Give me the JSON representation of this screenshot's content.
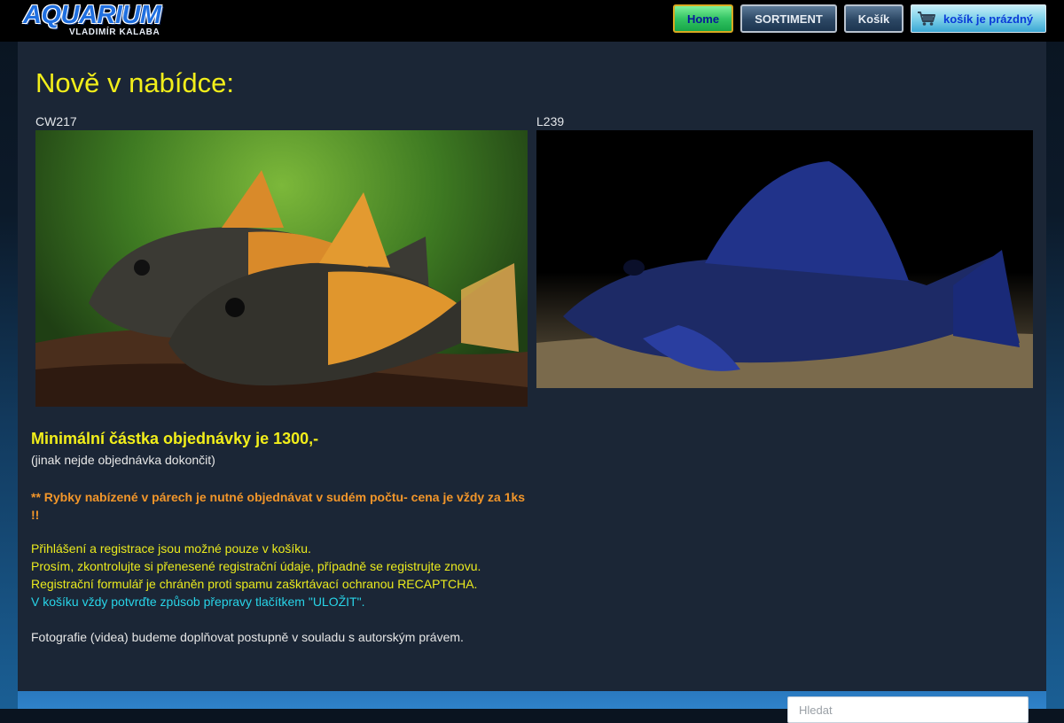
{
  "header": {
    "logo_title": "AQUARIUM",
    "logo_subtitle": "VLADIMÍR KALABA",
    "nav": {
      "home": "Home",
      "sortiment": "SORTIMENT",
      "kosik": "Košík",
      "cart_status": "košík je prázdný"
    }
  },
  "main": {
    "title": "Nově v nabídce:",
    "products": [
      {
        "caption": "CW217",
        "image": "fish-photo-corydoras"
      },
      {
        "caption": "L239",
        "image": "fish-photo-pleco"
      }
    ],
    "min_order": "Minimální částka objednávky je 1300,-",
    "min_order_note": "(jinak nejde objednávka dokončit)",
    "pairs_warning": "** Rybky nabízené v párech je nutné objednávat v sudém počtu- cena je vždy za 1ks !!",
    "info_login": "Přihlášení a registrace jsou možné pouze v košíku.",
    "info_check": "Prosím, zkontrolujte si přenesené registrační údaje, případně se registrujte znovu.",
    "info_captcha": "Registrační formulář je chráněn proti spamu zaškrtávací ochranou RECAPTCHA.",
    "info_shipping": "V košíku vždy potvrďte způsob přepravy tlačítkem \"ULOŽIT\".",
    "info_photos": "Fotografie (videa) budeme doplňovat postupně v souladu s autorským právem."
  },
  "footer": {
    "search_placeholder": "Hledat"
  },
  "colors": {
    "accent_yellow": "#f2ee1a",
    "warning_orange": "#f2962a",
    "info_cyan": "#28d4e8",
    "panel_bg": "#1b2636",
    "footer_blue": "#2a79bf"
  }
}
